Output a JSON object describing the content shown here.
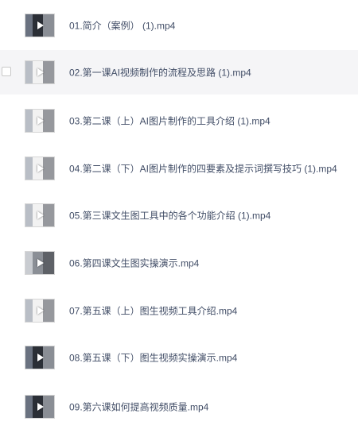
{
  "files": [
    {
      "name": "01.简介（案例） (1).mp4",
      "thumb": "dark",
      "hovered": false,
      "show_checkbox": false
    },
    {
      "name": "02.第一课AI视频制作的流程及思路 (1).mp4",
      "thumb": "light",
      "hovered": true,
      "show_checkbox": true
    },
    {
      "name": "03.第二课（上）AI图片制作的工具介绍 (1).mp4",
      "thumb": "light",
      "hovered": false,
      "show_checkbox": false
    },
    {
      "name": "04.第二课（下）AI图片制作的四要素及提示词撰写技巧 (1).mp4",
      "thumb": "light",
      "hovered": false,
      "show_checkbox": false
    },
    {
      "name": "05.第三课文生图工具中的各个功能介绍 (1).mp4",
      "thumb": "light",
      "hovered": false,
      "show_checkbox": false
    },
    {
      "name": "06.第四课文生图实操演示.mp4",
      "thumb": "gray",
      "hovered": false,
      "show_checkbox": false
    },
    {
      "name": "07.第五课（上）图生视频工具介绍.mp4",
      "thumb": "light",
      "hovered": false,
      "show_checkbox": false
    },
    {
      "name": "08.第五课（下）图生视频实操演示.mp4",
      "thumb": "dark",
      "hovered": false,
      "show_checkbox": false
    },
    {
      "name": "09.第六课如何提高视频质量.mp4",
      "thumb": "dark",
      "hovered": false,
      "show_checkbox": false
    }
  ],
  "colors": {
    "text": "#424e67",
    "hover_bg": "#f5f5f7"
  },
  "icons": {
    "thumbnail": "video-thumbnail-icon",
    "play": "play-icon",
    "checkbox": "checkbox"
  }
}
